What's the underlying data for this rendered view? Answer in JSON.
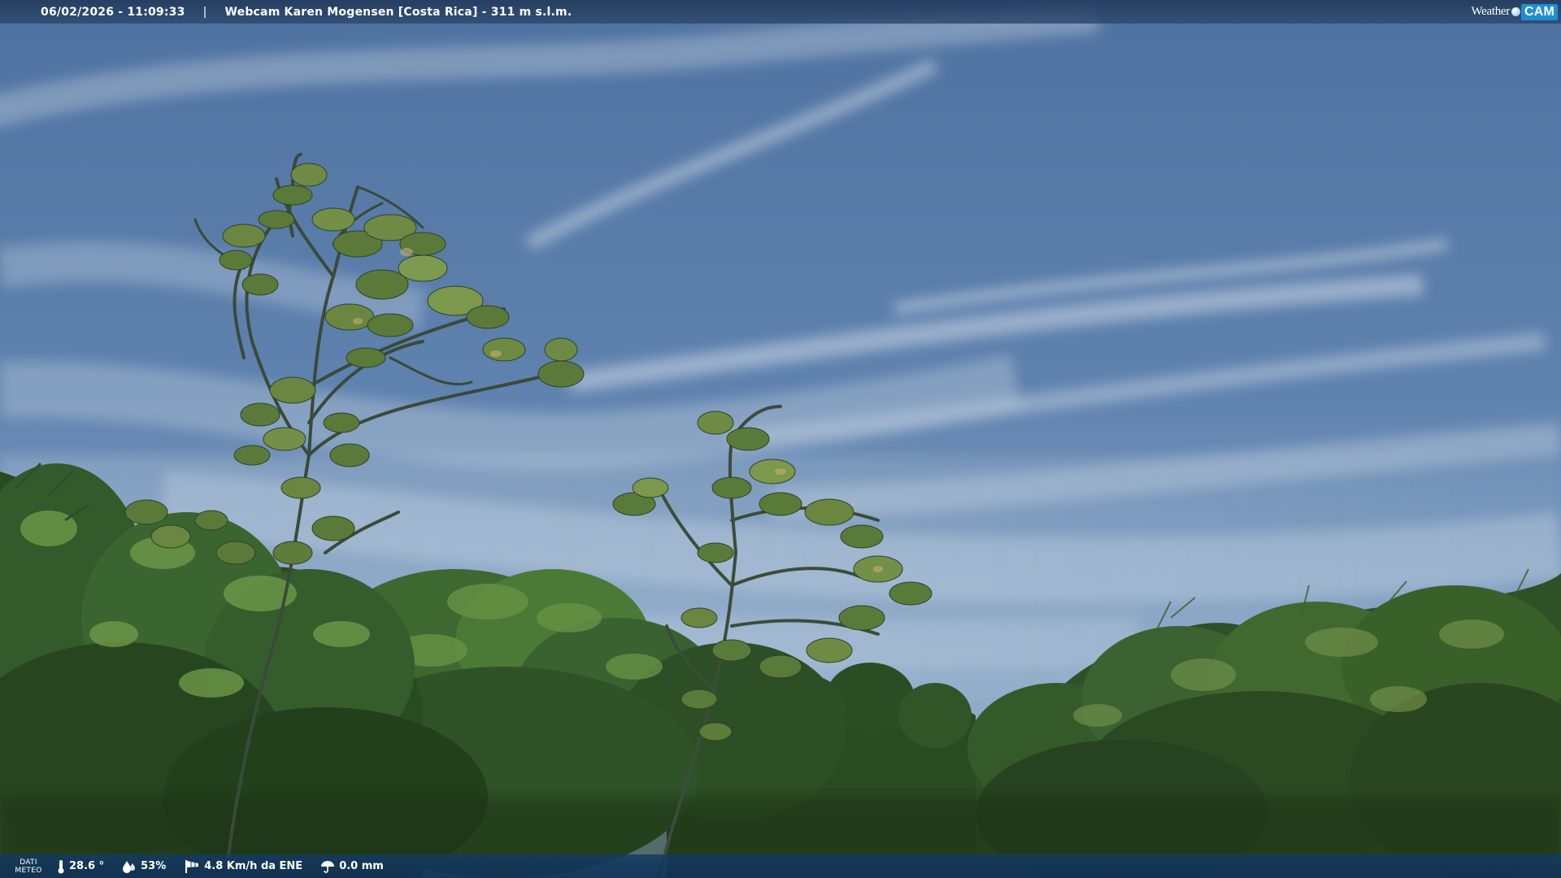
{
  "header": {
    "datetime": "06/02/2026 - 11:09:33",
    "separator": "|",
    "title": "Webcam Karen Mogensen [Costa Rica] - 311 m s.l.m.",
    "brand_word": "Weather",
    "brand_cam": "CAM"
  },
  "footer": {
    "label_line1": "DATI",
    "label_line2": "METEO",
    "temperature": "28.6 °",
    "humidity": "53%",
    "wind": "4.8 Km/h da ENE",
    "rain": "0.0 mm"
  },
  "icons": {
    "temperature": "thermometer-icon",
    "humidity": "drops-icon",
    "wind": "windsock-icon",
    "rain": "umbrella-icon"
  },
  "colors": {
    "sky_top": "#4a6f9e",
    "sky_horizon": "#9cb6d2",
    "foliage_dark": "#1e3a1a",
    "foliage_mid": "#3f6a2a",
    "foliage_light": "#7a9a4a",
    "bar_top": "#223a5c",
    "bar_bottom": "#103054",
    "brand_blue": "#1e8fd0"
  }
}
